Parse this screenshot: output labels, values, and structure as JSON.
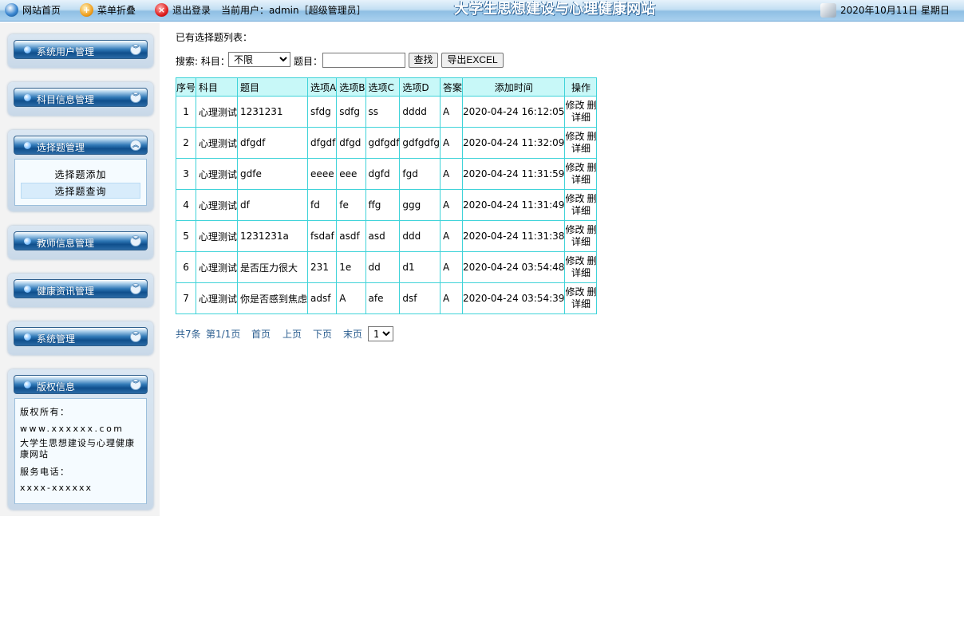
{
  "topbar": {
    "home": "网站首页",
    "fold": "菜单折叠",
    "logout": "退出登录",
    "current_user": "当前用户：admin［超级管理员］",
    "site_title": "大学生思想建设与心理健康网站",
    "date": "2020年10月11日 星期日"
  },
  "sidebar": {
    "panels": [
      {
        "title": "系统用户管理"
      },
      {
        "title": "科目信息管理"
      },
      {
        "title": "选择题管理",
        "items": [
          "选择题添加",
          "选择题查询"
        ]
      },
      {
        "title": "教师信息管理"
      },
      {
        "title": "健康资讯管理"
      },
      {
        "title": "系统管理"
      },
      {
        "title": "版权信息",
        "lines": [
          "版权所有：",
          "www.xxxxxx.com",
          "大学生思想建设与心理健康",
          "康网站",
          "服务电话：",
          "xxxx-xxxxxx"
        ]
      }
    ]
  },
  "main": {
    "list_title": "已有选择题列表：",
    "search_label": "搜索: 科目：",
    "subject_value": "不限",
    "topic_label": "题目：",
    "topic_value": "",
    "find_button": "查找",
    "export_button": "导出EXCEL",
    "columns": [
      "序号",
      "科目",
      "题目",
      "选项A",
      "选项B",
      "选项C",
      "选项D",
      "答案",
      "添加时间",
      "操作"
    ],
    "rows": [
      {
        "no": "1",
        "subject": "心理测试",
        "question": "1231231",
        "a": "sfdg",
        "b": "sdfg",
        "c": "ss",
        "d": "dddd",
        "answer": "A",
        "time": "2020-04-24 16:12:05"
      },
      {
        "no": "2",
        "subject": "心理测试",
        "question": "dfgdf",
        "a": "dfgdf",
        "b": "dfgd",
        "c": "gdfgdf",
        "d": "gdfgdfg",
        "answer": "A",
        "time": "2020-04-24 11:32:09"
      },
      {
        "no": "3",
        "subject": "心理测试",
        "question": "gdfe",
        "a": "eeee",
        "b": "eee",
        "c": "dgfd",
        "d": "fgd",
        "answer": "A",
        "time": "2020-04-24 11:31:59"
      },
      {
        "no": "4",
        "subject": "心理测试",
        "question": "df",
        "a": "fd",
        "b": "fe",
        "c": "ffg",
        "d": "ggg",
        "answer": "A",
        "time": "2020-04-24 11:31:49"
      },
      {
        "no": "5",
        "subject": "心理测试",
        "question": "1231231a",
        "a": "fsdaf",
        "b": "asdf",
        "c": "asd",
        "d": "ddd",
        "answer": "A",
        "time": "2020-04-24 11:31:38"
      },
      {
        "no": "6",
        "subject": "心理测试",
        "question": "是否压力很大",
        "a": "231",
        "b": "1e",
        "c": "dd",
        "d": "d1",
        "answer": "A",
        "time": "2020-04-24 03:54:48"
      },
      {
        "no": "7",
        "subject": "心理测试",
        "question": "你是否感到焦虑",
        "a": "adsf",
        "b": "A",
        "c": "afe",
        "d": "dsf",
        "answer": "A",
        "time": "2020-04-24 03:54:39"
      }
    ],
    "row_actions": {
      "edit": "修改",
      "delete": "删",
      "detail": "详细"
    },
    "pager": {
      "total": "共7条",
      "page": "第1/1页",
      "first": "首页",
      "prev": "上页",
      "next": "下页",
      "last": "末页",
      "current": "1"
    }
  },
  "colors": {
    "table_border": "#3fd3d9",
    "header_bg": "#c8f8f8",
    "link": "#2a5d8f"
  }
}
